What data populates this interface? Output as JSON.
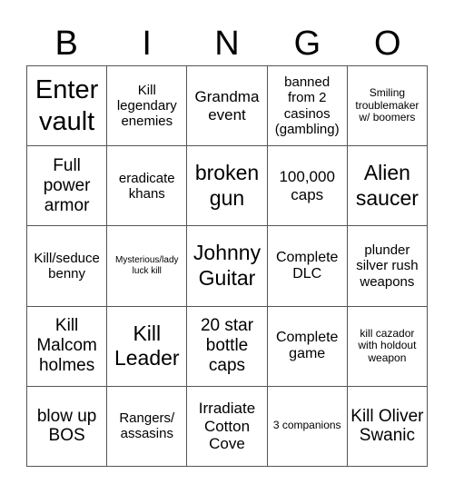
{
  "header": {
    "letters": [
      "B",
      "I",
      "N",
      "G",
      "O"
    ]
  },
  "board": {
    "cells": [
      [
        "Enter vault",
        "Kill legendary enemies",
        "Grandma event",
        "banned from 2 casinos (gambling)",
        "Smiling troublemaker w/ boomers"
      ],
      [
        "Full power armor",
        "eradicate khans",
        "broken gun",
        "100,000 caps",
        "Alien saucer"
      ],
      [
        "Kill/seduce benny",
        "Mysterious/lady luck kill",
        "Johnny Guitar",
        "Complete DLC",
        "plunder silver rush weapons"
      ],
      [
        "Kill Malcom holmes",
        "Kill Leader",
        "20 star bottle caps",
        "Complete game",
        "kill cazador with holdout weapon"
      ],
      [
        "blow up BOS",
        "Rangers/ assasins",
        "Irradiate Cotton Cove",
        "3 companions",
        "Kill Oliver Swanic"
      ]
    ]
  }
}
